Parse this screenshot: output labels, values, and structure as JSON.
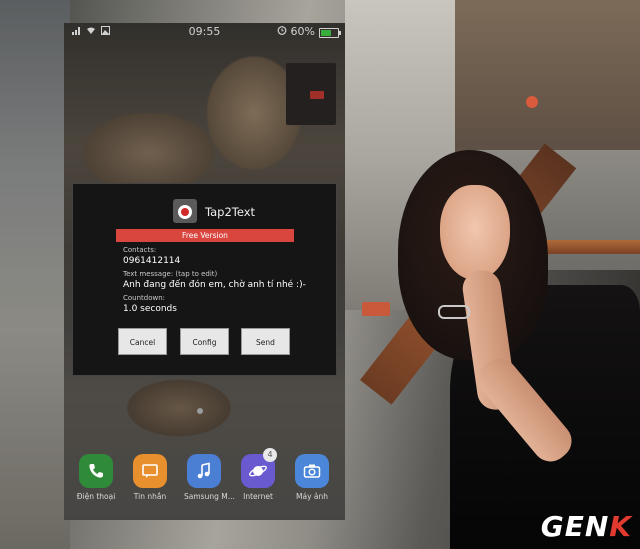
{
  "status_bar": {
    "time": "09:55",
    "battery": "60%",
    "battery_level": 0.6,
    "left_icons": [
      "signal-icon",
      "wifi-icon",
      "image-icon"
    ],
    "alarm_icon": "alarm-icon"
  },
  "dialog": {
    "app_name": "Tap2Text",
    "version_banner": "Free Version",
    "contacts_label": "Contacts:",
    "contacts_value": "0961412114",
    "message_label": "Text message: (tap to edit)",
    "message_value": "Anh đang đến đón em, chờ anh tí nhé :)-",
    "countdown_label": "Countdown:",
    "countdown_value": "1.0 seconds",
    "buttons": {
      "cancel": "Cancel",
      "config": "Config",
      "send": "Send"
    }
  },
  "dock": [
    {
      "label": "Điện thoại",
      "icon": "phone-icon",
      "color": "#2f8a3a"
    },
    {
      "label": "Tin nhắn",
      "icon": "message-icon",
      "color": "#e8902d"
    },
    {
      "label": "Samsung M...",
      "icon": "music-icon",
      "color": "#4a7fd4"
    },
    {
      "label": "Internet",
      "icon": "internet-icon",
      "color": "#6a5ad0",
      "badge": "4"
    },
    {
      "label": "Máy ảnh",
      "icon": "camera-icon",
      "color": "#4b86d8"
    }
  ],
  "colors": {
    "accent_red": "#d8463e",
    "dialog_bg": "#151515"
  },
  "watermark": {
    "text_main": "GEN",
    "text_accent": "K"
  }
}
